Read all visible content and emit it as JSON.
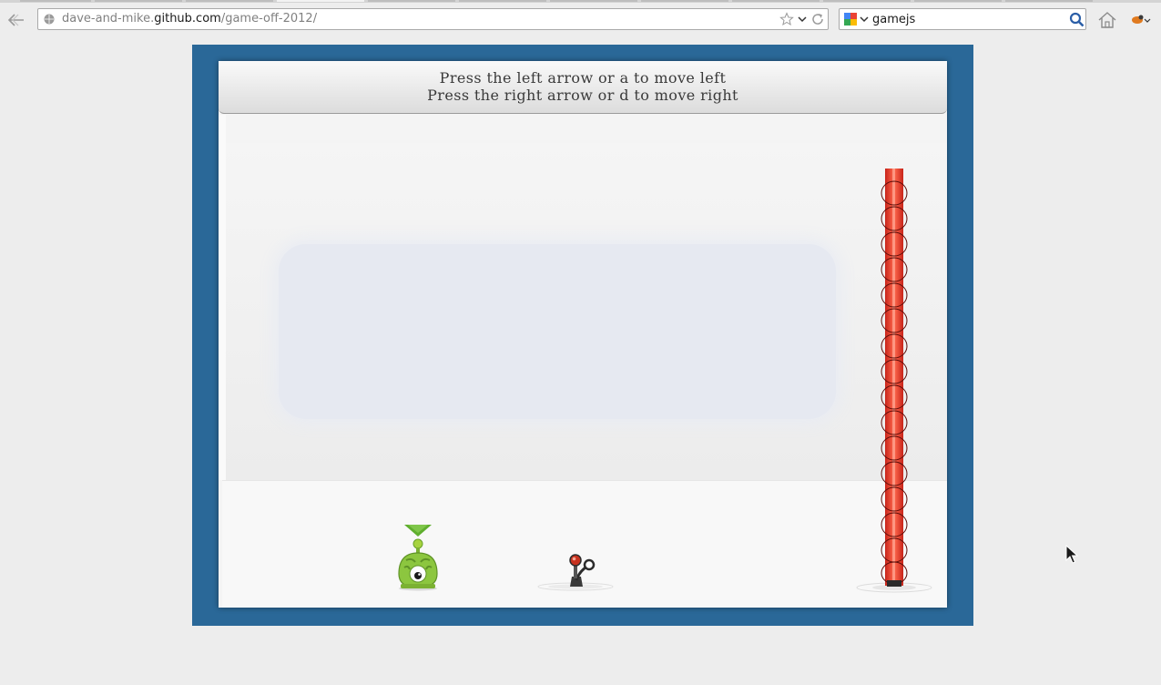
{
  "browser": {
    "url_prefix": "dave-and-mike.",
    "url_host": "github.com",
    "url_path": "/game-off-2012/",
    "search_query": "gamejs",
    "icons": [
      "back-arrow-icon",
      "globe-icon",
      "bookmark-star-icon",
      "dropdown-arrow-icon",
      "reload-icon",
      "google-icon",
      "magnifier-icon",
      "home-icon",
      "addon-icon"
    ]
  },
  "game": {
    "instruction_line1": "Press the left arrow or a to move left",
    "instruction_line2": "Press the right arrow or d to move right",
    "colors": {
      "frame": "#2a6898",
      "canvas": "#f4f4f4",
      "cloud": "#e6e9f1",
      "player_green": "#8cc63f",
      "laser_red": "#e8392b"
    },
    "sprites": [
      "green-alien-player",
      "lever-switch",
      "red-laser-beam"
    ]
  }
}
